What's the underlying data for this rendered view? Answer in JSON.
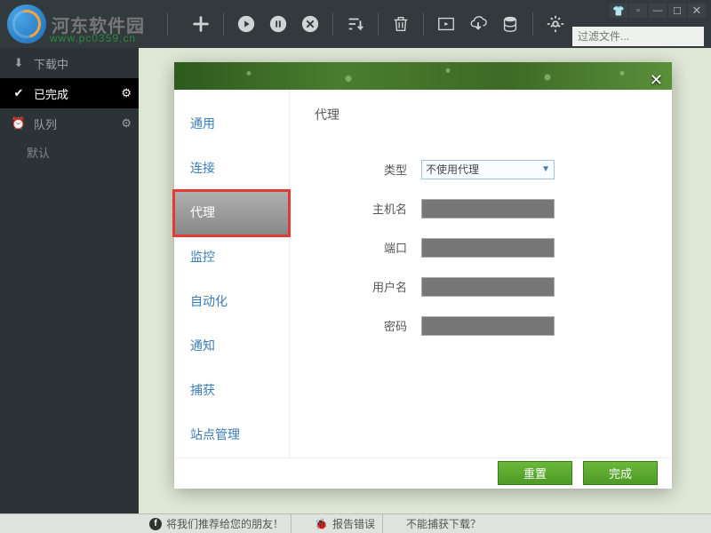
{
  "brand": {
    "name": "河东软件园",
    "url": "www.pc0359.cn"
  },
  "toolbar_icons": [
    "plus",
    "play",
    "pause",
    "cancel",
    "sort",
    "trash",
    "film",
    "cloud-down",
    "database",
    "gear"
  ],
  "search": {
    "placeholder": "过滤文件...",
    "value": ""
  },
  "sidebar": {
    "items": [
      {
        "icon": "download",
        "label": "下载中"
      },
      {
        "icon": "check",
        "label": "已完成",
        "active": true,
        "gear": true
      },
      {
        "icon": "clock",
        "label": "队列",
        "gear": true
      }
    ],
    "sub": "默认"
  },
  "dialog": {
    "nav": [
      "通用",
      "连接",
      "代理",
      "监控",
      "自动化",
      "通知",
      "捕获",
      "站点管理"
    ],
    "selected_index": 2,
    "title": "代理",
    "fields": {
      "type_label": "类型",
      "type_value": "不使用代理",
      "host_label": "主机名",
      "port_label": "端口",
      "user_label": "用户名",
      "pass_label": "密码"
    },
    "buttons": {
      "reset": "重置",
      "done": "完成"
    }
  },
  "footer": {
    "recommend": "将我们推荐给您的朋友！",
    "report": "报告错误",
    "capture_fail": "不能捕获下载？"
  }
}
